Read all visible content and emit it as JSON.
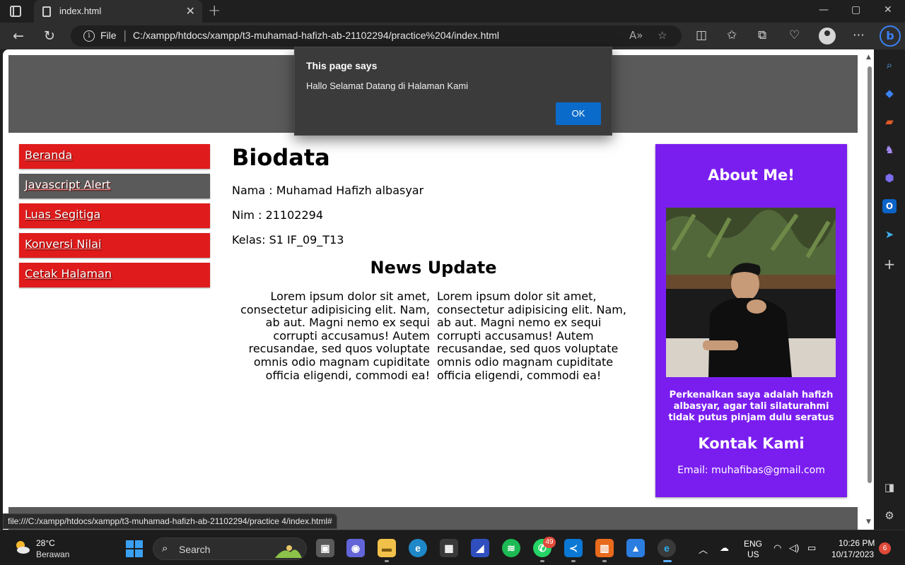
{
  "browser": {
    "tab_title": "index.html",
    "tab_close": "✕",
    "new_tab": "+",
    "url_scheme": "File",
    "url_separator": "|",
    "url": "C:/xampp/htdocs/xampp/t3-muhamad-hafizh-ab-21102294/practice%204/index.html",
    "read_aloud_icon": "A»",
    "status_url": "file:///C:/xampp/htdocs/xampp/t3-muhamad-hafizh-ab-21102294/practice 4/index.html#"
  },
  "dialog": {
    "title": "This page says",
    "message": "Hallo Selamat Datang di Halaman Kami",
    "ok_label": "OK"
  },
  "nav": {
    "items": [
      {
        "label": "Beranda",
        "active": false
      },
      {
        "label": "Javascript Alert",
        "active": true
      },
      {
        "label": "Luas Segitiga",
        "active": false
      },
      {
        "label": "Konversi Nilai",
        "active": false
      },
      {
        "label": "Cetak Halaman",
        "active": false
      }
    ]
  },
  "content": {
    "title": "Biodata",
    "nama": "Nama : Muhamad Hafizh albasyar",
    "nim": "Nim : 21102294",
    "kelas": "Kelas: S1 IF_09_T13",
    "news_title": "News Update",
    "news_left": "Lorem ipsum dolor sit amet, consectetur adipisicing elit. Nam, ab aut. Magni nemo ex sequi corrupti accusamus! Autem recusandae, sed quos voluptate omnis odio magnam cupiditate officia eligendi, commodi ea!",
    "news_right": "Lorem ipsum dolor sit amet, consectetur adipisicing elit. Nam, ab aut. Magni nemo ex sequi corrupti accusamus! Autem recusandae, sed quos voluptate omnis odio magnam cupiditate officia eligendi, commodi ea!"
  },
  "aside": {
    "title": "About Me!",
    "intro": "Perkenalkan saya adalah hafizh albasyar, agar tali silaturahmi tidak putus pinjam dulu seratus",
    "contact_title": "Kontak Kami",
    "email": "Email: muhafibas@gmail.com"
  },
  "taskbar": {
    "temperature": "28°C",
    "weather": "Berawan",
    "search_label": "Search",
    "whatsapp_badge": "49",
    "lang_primary": "ENG",
    "lang_secondary": "US",
    "time": "10:26 PM",
    "date": "10/17/2023",
    "notifications": "6"
  },
  "colors": {
    "nav_red": "#e01b1b",
    "nav_active": "#5a5a5a",
    "aside_purple": "#7a1ef0",
    "dialog_ok": "#0b6bcb"
  }
}
